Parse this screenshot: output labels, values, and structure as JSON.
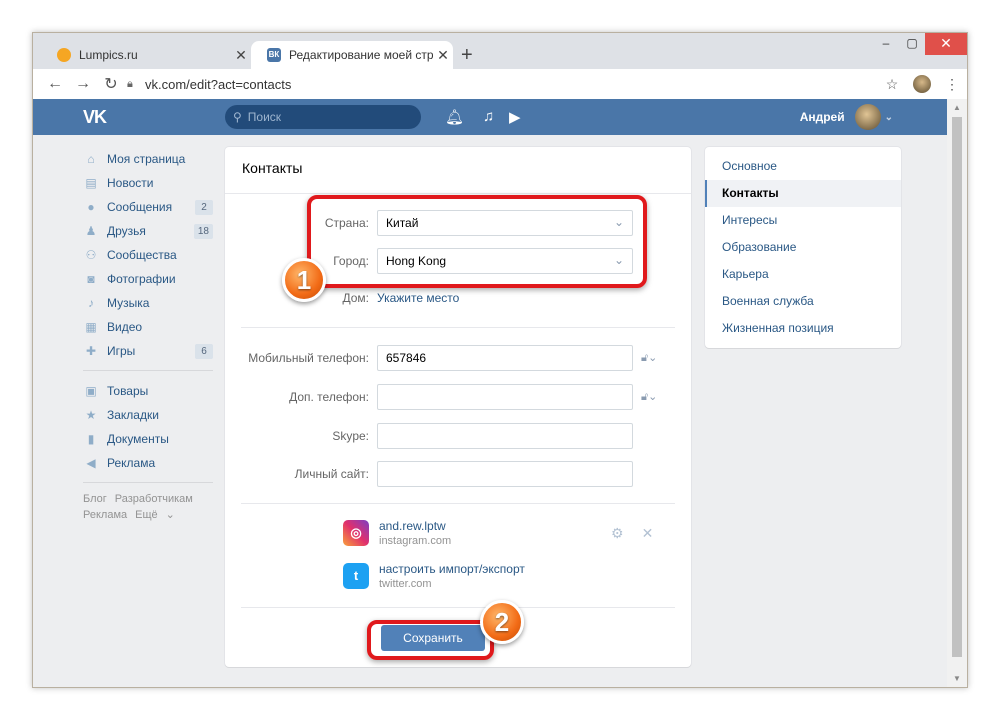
{
  "browser": {
    "tabs": [
      {
        "title": "Lumpics.ru"
      },
      {
        "title": "Редактирование моей страниц",
        "favicon": "ВК"
      }
    ],
    "url": "vk.com/edit?act=contacts",
    "new_tab": "+",
    "win_min": "‒",
    "win_max": "▢",
    "win_close": "✕"
  },
  "vk": {
    "logo": "VK",
    "search_placeholder": "Поиск",
    "user_name": "Андрей",
    "sidebar": [
      {
        "label": "Моя страница",
        "icon": "home-icon",
        "badge": ""
      },
      {
        "label": "Новости",
        "icon": "news-icon",
        "badge": ""
      },
      {
        "label": "Сообщения",
        "icon": "messages-icon",
        "badge": "2"
      },
      {
        "label": "Друзья",
        "icon": "friends-icon",
        "badge": "18"
      },
      {
        "label": "Сообщества",
        "icon": "communities-icon",
        "badge": ""
      },
      {
        "label": "Фотографии",
        "icon": "photos-icon",
        "badge": ""
      },
      {
        "label": "Музыка",
        "icon": "music-icon",
        "badge": ""
      },
      {
        "label": "Видео",
        "icon": "video-icon",
        "badge": ""
      },
      {
        "label": "Игры",
        "icon": "games-icon",
        "badge": "6"
      },
      {
        "label": "Товары",
        "icon": "goods-icon",
        "badge": ""
      },
      {
        "label": "Закладки",
        "icon": "bookmarks-icon",
        "badge": ""
      },
      {
        "label": "Документы",
        "icon": "documents-icon",
        "badge": ""
      },
      {
        "label": "Реклама",
        "icon": "ads-icon",
        "badge": ""
      }
    ],
    "footer": [
      "Блог",
      "Разработчикам",
      "Реклама",
      "Ещё"
    ],
    "contacts": {
      "title": "Контакты",
      "country_label": "Страна:",
      "country_value": "Китай",
      "city_label": "Город:",
      "city_value": "Hong Kong",
      "home_label": "Дом:",
      "home_link": "Укажите место",
      "mobile_label": "Мобильный телефон:",
      "mobile_value": "657846",
      "extra_phone_label": "Доп. телефон:",
      "extra_phone_value": "",
      "skype_label": "Skype:",
      "skype_value": "",
      "site_label": "Личный сайт:",
      "site_value": "",
      "instagram_name": "and.rew.lptw",
      "instagram_domain": "instagram.com",
      "twitter_action": "настроить импорт/экспорт",
      "twitter_domain": "twitter.com",
      "save_label": "Сохранить"
    },
    "right_menu": [
      "Основное",
      "Контакты",
      "Интересы",
      "Образование",
      "Карьера",
      "Военная служба",
      "Жизненная позиция"
    ],
    "right_menu_active": "Контакты"
  },
  "markers": {
    "m1": "1",
    "m2": "2"
  },
  "colors": {
    "vk_blue": "#4a76a8",
    "button": "#5181b8",
    "highlight": "#e0191c",
    "marker": "#f26b16"
  }
}
